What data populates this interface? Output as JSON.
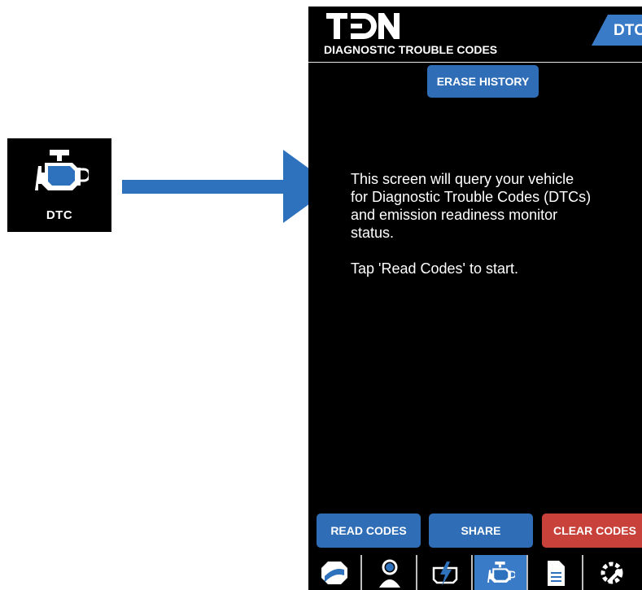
{
  "tile": {
    "label": "DTC",
    "icon": "engine-icon"
  },
  "app": {
    "logo_text": "TDN",
    "screen_tab": "DTC",
    "header_title": "DIAGNOSTIC TROUBLE CODES",
    "erase_button": "ERASE HISTORY",
    "info_lines": [
      "This screen will query your vehicle",
      "for Diagnostic Trouble Codes (DTCs)",
      "and emission readiness monitor",
      "status."
    ],
    "tap_hint": "Tap 'Read Codes' to start.",
    "read_button": "READ CODES",
    "share_button": "SHARE",
    "clear_button": "CLEAR CODES",
    "tabs": [
      {
        "icon": "dashboard-icon"
      },
      {
        "icon": "user-icon"
      },
      {
        "icon": "battery-icon"
      },
      {
        "icon": "engine-icon",
        "active": true
      },
      {
        "icon": "document-icon"
      },
      {
        "icon": "gear-wrench-icon"
      }
    ]
  },
  "colors": {
    "accent": "#3a7bc8",
    "button_blue": "#2f6eb6",
    "button_red": "#c8423b",
    "arrow": "#2e72bd"
  }
}
